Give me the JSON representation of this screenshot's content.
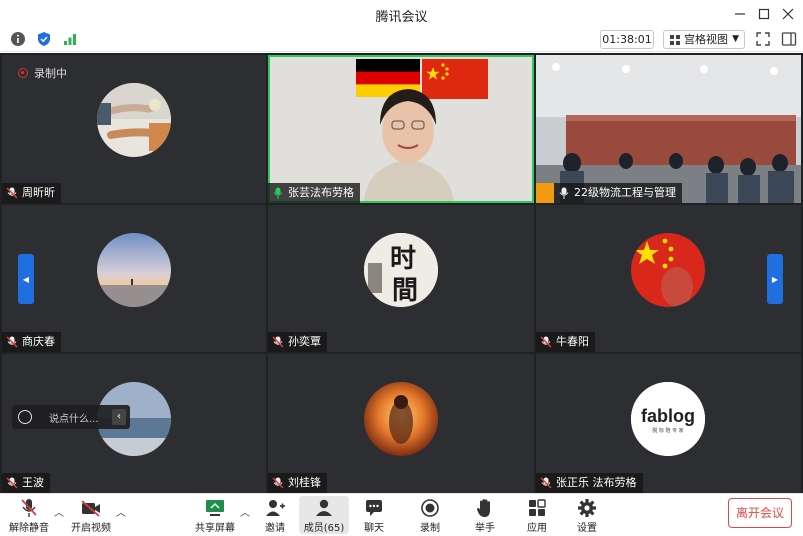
{
  "window": {
    "title": "腾讯会议"
  },
  "toolbar": {
    "timer": "01:38:01",
    "view_label": "宫格视图"
  },
  "recording": {
    "label": "录制中"
  },
  "participants": [
    {
      "name": "周昕昕"
    },
    {
      "name": "张芸法布劳格"
    },
    {
      "name": "22级物流工程与管理"
    },
    {
      "name": "商庆春"
    },
    {
      "name": "孙奕覃"
    },
    {
      "name": "牛春阳"
    },
    {
      "name": "王波"
    },
    {
      "name": "刘桂锋"
    },
    {
      "name": "张正乐 法布劳格"
    }
  ],
  "avatars": {
    "time_chars": "时間",
    "logo_main": "fablog",
    "logo_sub": "脱 标 陪 专 家"
  },
  "chat": {
    "placeholder": "说点什么..."
  },
  "controls": {
    "unmute": "解除静音",
    "start_video": "开启视频",
    "share_screen": "共享屏幕",
    "invite": "邀请",
    "members": "成员(65)",
    "chat": "聊天",
    "record": "录制",
    "raise_hand": "举手",
    "apps": "应用",
    "settings": "设置",
    "leave": "离开会议"
  },
  "colors": {
    "active_speaker": "#2fc85d",
    "nav_arrow": "#1f6fe0",
    "leave": "#e04848",
    "muted_red": "#e03c3c"
  }
}
